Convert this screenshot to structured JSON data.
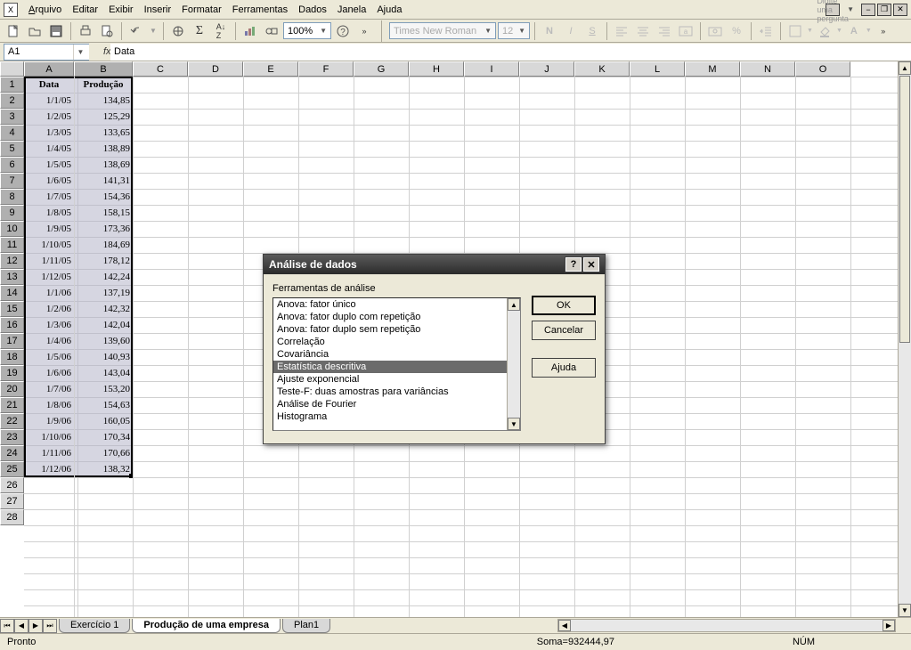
{
  "menus": [
    "Arquivo",
    "Editar",
    "Exibir",
    "Inserir",
    "Formatar",
    "Ferramentas",
    "Dados",
    "Janela",
    "Ajuda"
  ],
  "questionPlaceholder": "Digite uma pergunta",
  "nameBox": "A1",
  "formulaValue": "Data",
  "zoom": "100%",
  "font": {
    "name": "Times New Roman",
    "size": "12"
  },
  "columns": [
    "A",
    "B",
    "C",
    "D",
    "E",
    "F",
    "G",
    "H",
    "I",
    "J",
    "K",
    "L",
    "M",
    "N",
    "O"
  ],
  "colWidthA": 56,
  "colWidthB": 66,
  "colWidthOther": 62,
  "rowCount": 28,
  "headers": {
    "A": "Data",
    "B": "Produção"
  },
  "data": [
    {
      "date": "1/1/05",
      "value": "134,85"
    },
    {
      "date": "1/2/05",
      "value": "125,29"
    },
    {
      "date": "1/3/05",
      "value": "133,65"
    },
    {
      "date": "1/4/05",
      "value": "138,89"
    },
    {
      "date": "1/5/05",
      "value": "138,69"
    },
    {
      "date": "1/6/05",
      "value": "141,31"
    },
    {
      "date": "1/7/05",
      "value": "154,36"
    },
    {
      "date": "1/8/05",
      "value": "158,15"
    },
    {
      "date": "1/9/05",
      "value": "173,36"
    },
    {
      "date": "1/10/05",
      "value": "184,69"
    },
    {
      "date": "1/11/05",
      "value": "178,12"
    },
    {
      "date": "1/12/05",
      "value": "142,24"
    },
    {
      "date": "1/1/06",
      "value": "137,19"
    },
    {
      "date": "1/2/06",
      "value": "142,32"
    },
    {
      "date": "1/3/06",
      "value": "142,04"
    },
    {
      "date": "1/4/06",
      "value": "139,60"
    },
    {
      "date": "1/5/06",
      "value": "140,93"
    },
    {
      "date": "1/6/06",
      "value": "143,04"
    },
    {
      "date": "1/7/06",
      "value": "153,20"
    },
    {
      "date": "1/8/06",
      "value": "154,63"
    },
    {
      "date": "1/9/06",
      "value": "160,05"
    },
    {
      "date": "1/10/06",
      "value": "170,34"
    },
    {
      "date": "1/11/06",
      "value": "170,66"
    },
    {
      "date": "1/12/06",
      "value": "138,32"
    }
  ],
  "tabs": {
    "t1": "Exercício 1",
    "t2": "Produção de uma empresa",
    "t3": "Plan1"
  },
  "status": {
    "ready": "Pronto",
    "sumLabel": "Soma=",
    "sumValue": "932444,97",
    "num": "NÚM"
  },
  "dialog": {
    "title": "Análise de dados",
    "label": "Ferramentas de análise",
    "items": [
      "Anova: fator único",
      "Anova: fator duplo com repetição",
      "Anova: fator duplo sem repetição",
      "Correlação",
      "Covariância",
      "Estatística descritiva",
      "Ajuste exponencial",
      "Teste-F: duas amostras para variâncias",
      "Análise de Fourier",
      "Histograma"
    ],
    "selectedIndex": 5,
    "ok": "OK",
    "cancel": "Cancelar",
    "help": "Ajuda"
  }
}
